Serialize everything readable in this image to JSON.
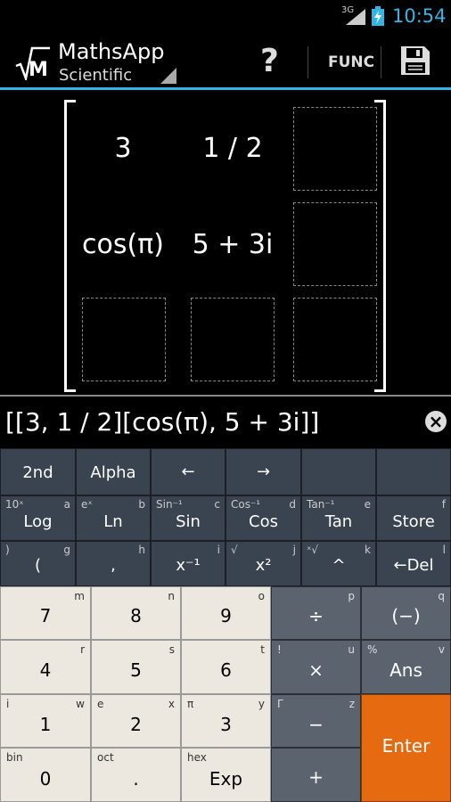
{
  "status_bar": {
    "network": "3G",
    "time": "10:54"
  },
  "action_bar": {
    "logo": "M",
    "title": "MathsApp",
    "mode": "Scientific",
    "help_label": "?",
    "func_label": "FUNC",
    "save_icon": "save-icon"
  },
  "matrix": {
    "rows": [
      [
        "3",
        "1 / 2",
        ""
      ],
      [
        "cos(π)",
        "5 + 3i",
        ""
      ],
      [
        "",
        "",
        ""
      ]
    ]
  },
  "input": {
    "expression": "[[3, 1 / 2][cos(π), 5 + 3i]]",
    "clear_label": "×"
  },
  "keys": {
    "k2nd": {
      "main": "2nd"
    },
    "alpha": {
      "main": "Alpha"
    },
    "left": {
      "main": "←"
    },
    "right": {
      "main": "→"
    },
    "log": {
      "main": "Log",
      "tl": "10ˣ",
      "tr": "a"
    },
    "ln": {
      "main": "Ln",
      "tl": "eˣ",
      "tr": "b"
    },
    "sin": {
      "main": "Sin",
      "tl": "Sin⁻¹",
      "tr": "c"
    },
    "cos": {
      "main": "Cos",
      "tl": "Cos⁻¹",
      "tr": "d"
    },
    "tan": {
      "main": "Tan",
      "tl": "Tan⁻¹",
      "tr": "e"
    },
    "store": {
      "main": "Store",
      "tr": "f"
    },
    "lparen": {
      "main": "(",
      "tl": ")",
      "tr": "g"
    },
    "comma": {
      "main": ",",
      "tr": "h"
    },
    "xinv": {
      "main": "x⁻¹",
      "tr": "i"
    },
    "xsq": {
      "main": "x²",
      "tl": "√",
      "tr": "j"
    },
    "pow": {
      "main": "^",
      "tl": "ˣ√",
      "tr": "k"
    },
    "del": {
      "main": "←Del",
      "tr": "l"
    },
    "n7": {
      "main": "7",
      "tr": "m"
    },
    "n8": {
      "main": "8",
      "tr": "n"
    },
    "n9": {
      "main": "9",
      "tr": "o"
    },
    "div": {
      "main": "÷",
      "tr": "p"
    },
    "neg": {
      "main": "(−)",
      "tr": "q"
    },
    "n4": {
      "main": "4",
      "tr": "r"
    },
    "n5": {
      "main": "5",
      "tr": "s"
    },
    "n6": {
      "main": "6",
      "tr": "t"
    },
    "mul": {
      "main": "×",
      "tl": "!",
      "tr": "u"
    },
    "ans": {
      "main": "Ans",
      "tl": "%",
      "tr": "v"
    },
    "n1": {
      "main": "1",
      "tl": "i",
      "tr": "w"
    },
    "n2": {
      "main": "2",
      "tl": "e",
      "tr": "x"
    },
    "n3": {
      "main": "3",
      "tl": "π",
      "tr": "y"
    },
    "minus": {
      "main": "−",
      "tl": "Γ",
      "tr": "z"
    },
    "enter": {
      "main": "Enter"
    },
    "n0": {
      "main": "0",
      "tl": "bin"
    },
    "dot": {
      "main": ".",
      "tl": "oct"
    },
    "exp": {
      "main": "Exp",
      "tl": "hex"
    },
    "plus": {
      "main": "+"
    }
  },
  "colors": {
    "accent": "#33b5e5",
    "enter": "#e66a10",
    "func_key": "#3a4350",
    "op_key": "#5b646e",
    "num_key": "#ece8e0"
  }
}
